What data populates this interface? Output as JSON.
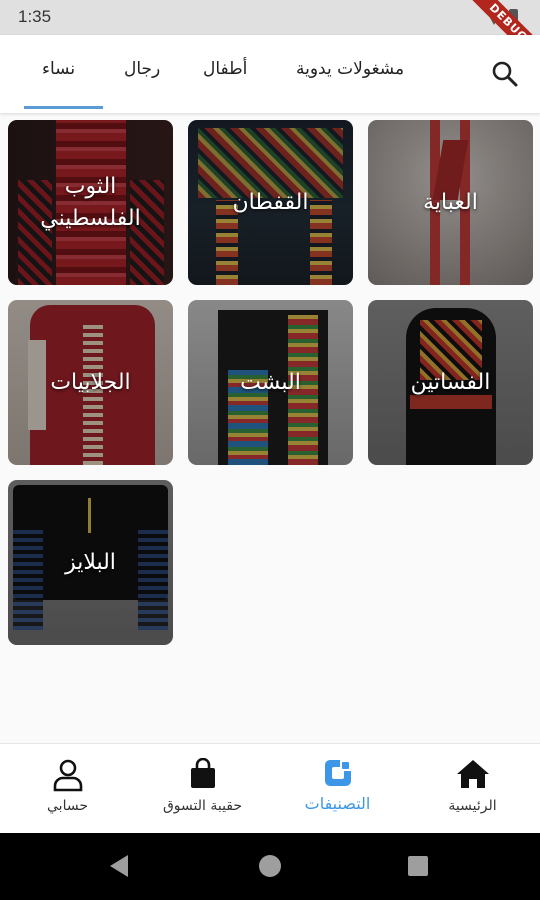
{
  "status": {
    "time": "1:35",
    "debug_banner": "DEBUG"
  },
  "topbar": {
    "search_icon": "search-icon",
    "tabs": [
      {
        "label": "مشغولات يدوية",
        "selected": false
      },
      {
        "label": "أطفال",
        "selected": false
      },
      {
        "label": "رجال",
        "selected": false
      },
      {
        "label": "نساء",
        "selected": true
      }
    ]
  },
  "categories": [
    {
      "label": "العباية"
    },
    {
      "label": "القفطان"
    },
    {
      "label": "الثوب الفلسطيني"
    },
    {
      "label": "الفساتين"
    },
    {
      "label": "البشت"
    },
    {
      "label": "الجلابيات"
    },
    {
      "label": "البلايز"
    }
  ],
  "bottom_nav": {
    "items": [
      {
        "label": "الرئيسية",
        "icon": "home-icon",
        "active": false
      },
      {
        "label": "التصنيفات",
        "icon": "categories-icon",
        "active": true
      },
      {
        "label": "حقيبة التسوق",
        "icon": "shopping-bag-icon",
        "active": false
      },
      {
        "label": "حسابي",
        "icon": "person-icon",
        "active": false
      }
    ]
  },
  "colors": {
    "accent": "#3d97e6",
    "tab_indicator": "#5b9bd5",
    "debug": "#b3261e"
  }
}
